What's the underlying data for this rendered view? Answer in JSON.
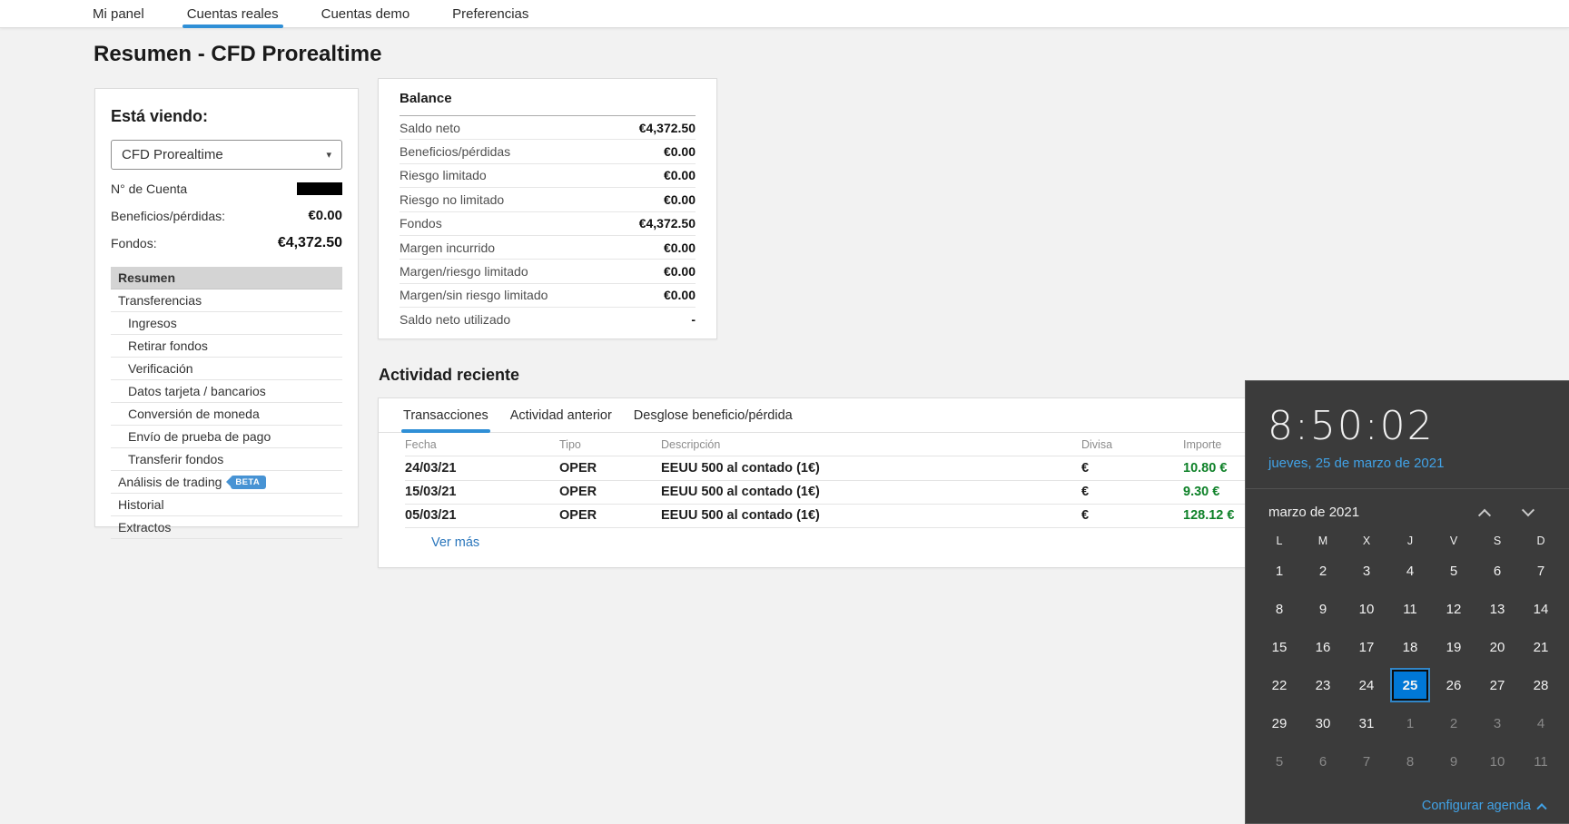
{
  "colors": {
    "accent_blue": "#2f8fd6",
    "link_blue": "#2a76bc",
    "positive_green": "#0e8128",
    "calendar_accent": "#0078d7",
    "flyout_link_blue": "#41a2e6"
  },
  "nav": {
    "items": [
      {
        "label": "Mi panel",
        "active": false
      },
      {
        "label": "Cuentas reales",
        "active": true
      },
      {
        "label": "Cuentas demo",
        "active": false
      },
      {
        "label": "Preferencias",
        "active": false
      }
    ]
  },
  "page": {
    "title": "Resumen - CFD Prorealtime"
  },
  "sidebar": {
    "heading": "Está viendo:",
    "account_select": {
      "value": "CFD Prorealtime"
    },
    "rows": [
      {
        "label": "N° de Cuenta",
        "value_redacted": true
      },
      {
        "label": "Beneficios/pérdidas:",
        "value": "€0.00"
      },
      {
        "label": "Fondos:",
        "value": "€4,372.50"
      }
    ],
    "menu": [
      {
        "label": "Resumen",
        "selected": true
      },
      {
        "label": "Transferencias"
      },
      {
        "label": "Ingresos",
        "indent": true
      },
      {
        "label": "Retirar fondos",
        "indent": true
      },
      {
        "label": "Verificación",
        "indent": true
      },
      {
        "label": "Datos tarjeta / bancarios",
        "indent": true
      },
      {
        "label": "Conversión de moneda",
        "indent": true
      },
      {
        "label": "Envío de prueba de pago",
        "indent": true
      },
      {
        "label": "Transferir fondos",
        "indent": true
      },
      {
        "label": "Análisis de trading",
        "badge": "BETA"
      },
      {
        "label": "Historial"
      },
      {
        "label": "Extractos"
      }
    ]
  },
  "balance": {
    "title": "Balance",
    "rows": [
      {
        "label": "Saldo neto",
        "value": "€4,372.50"
      },
      {
        "label": "Beneficios/pérdidas",
        "value": "€0.00"
      },
      {
        "label": "Riesgo limitado",
        "value": "€0.00"
      },
      {
        "label": "Riesgo no limitado",
        "value": "€0.00"
      },
      {
        "label": "Fondos",
        "value": "€4,372.50"
      },
      {
        "label": "Margen incurrido",
        "value": "€0.00"
      },
      {
        "label": "Margen/riesgo limitado",
        "value": "€0.00"
      },
      {
        "label": "Margen/sin riesgo limitado",
        "value": "€0.00"
      },
      {
        "label": "Saldo neto utilizado",
        "value": "-"
      }
    ]
  },
  "activity": {
    "title": "Actividad reciente",
    "tabs": [
      {
        "label": "Transacciones",
        "active": true
      },
      {
        "label": "Actividad anterior",
        "active": false
      },
      {
        "label": "Desglose beneficio/pérdida",
        "active": false
      }
    ],
    "columns": [
      "Fecha",
      "Tipo",
      "Descripción",
      "Divisa",
      "Importe"
    ],
    "rows": [
      {
        "fecha": "24/03/21",
        "tipo": "OPER",
        "descripcion": "EEUU 500 al contado (1€)",
        "divisa": "€",
        "importe": "10.80 €"
      },
      {
        "fecha": "15/03/21",
        "tipo": "OPER",
        "descripcion": "EEUU 500 al contado (1€)",
        "divisa": "€",
        "importe": "9.30 €"
      },
      {
        "fecha": "05/03/21",
        "tipo": "OPER",
        "descripcion": "EEUU 500 al contado (1€)",
        "divisa": "€",
        "importe": "128.12 €"
      }
    ],
    "more_link": "Ver más"
  },
  "clock_flyout": {
    "time": "8:50:02",
    "date": "jueves, 25 de marzo de 2021",
    "month_label": "marzo de 2021",
    "day_headers": [
      "L",
      "M",
      "X",
      "J",
      "V",
      "S",
      "D"
    ],
    "cells": [
      {
        "d": "1"
      },
      {
        "d": "2"
      },
      {
        "d": "3"
      },
      {
        "d": "4"
      },
      {
        "d": "5"
      },
      {
        "d": "6"
      },
      {
        "d": "7"
      },
      {
        "d": "8"
      },
      {
        "d": "9"
      },
      {
        "d": "10"
      },
      {
        "d": "11"
      },
      {
        "d": "12"
      },
      {
        "d": "13"
      },
      {
        "d": "14"
      },
      {
        "d": "15"
      },
      {
        "d": "16"
      },
      {
        "d": "17"
      },
      {
        "d": "18"
      },
      {
        "d": "19"
      },
      {
        "d": "20"
      },
      {
        "d": "21"
      },
      {
        "d": "22"
      },
      {
        "d": "23"
      },
      {
        "d": "24"
      },
      {
        "d": "25",
        "sel": true
      },
      {
        "d": "26"
      },
      {
        "d": "27"
      },
      {
        "d": "28"
      },
      {
        "d": "29"
      },
      {
        "d": "30"
      },
      {
        "d": "31"
      },
      {
        "d": "1",
        "dim": true
      },
      {
        "d": "2",
        "dim": true
      },
      {
        "d": "3",
        "dim": true
      },
      {
        "d": "4",
        "dim": true
      },
      {
        "d": "5",
        "dim": true
      },
      {
        "d": "6",
        "dim": true
      },
      {
        "d": "7",
        "dim": true
      },
      {
        "d": "8",
        "dim": true
      },
      {
        "d": "9",
        "dim": true
      },
      {
        "d": "10",
        "dim": true
      },
      {
        "d": "11",
        "dim": true
      }
    ],
    "agenda_link": "Configurar agenda"
  }
}
